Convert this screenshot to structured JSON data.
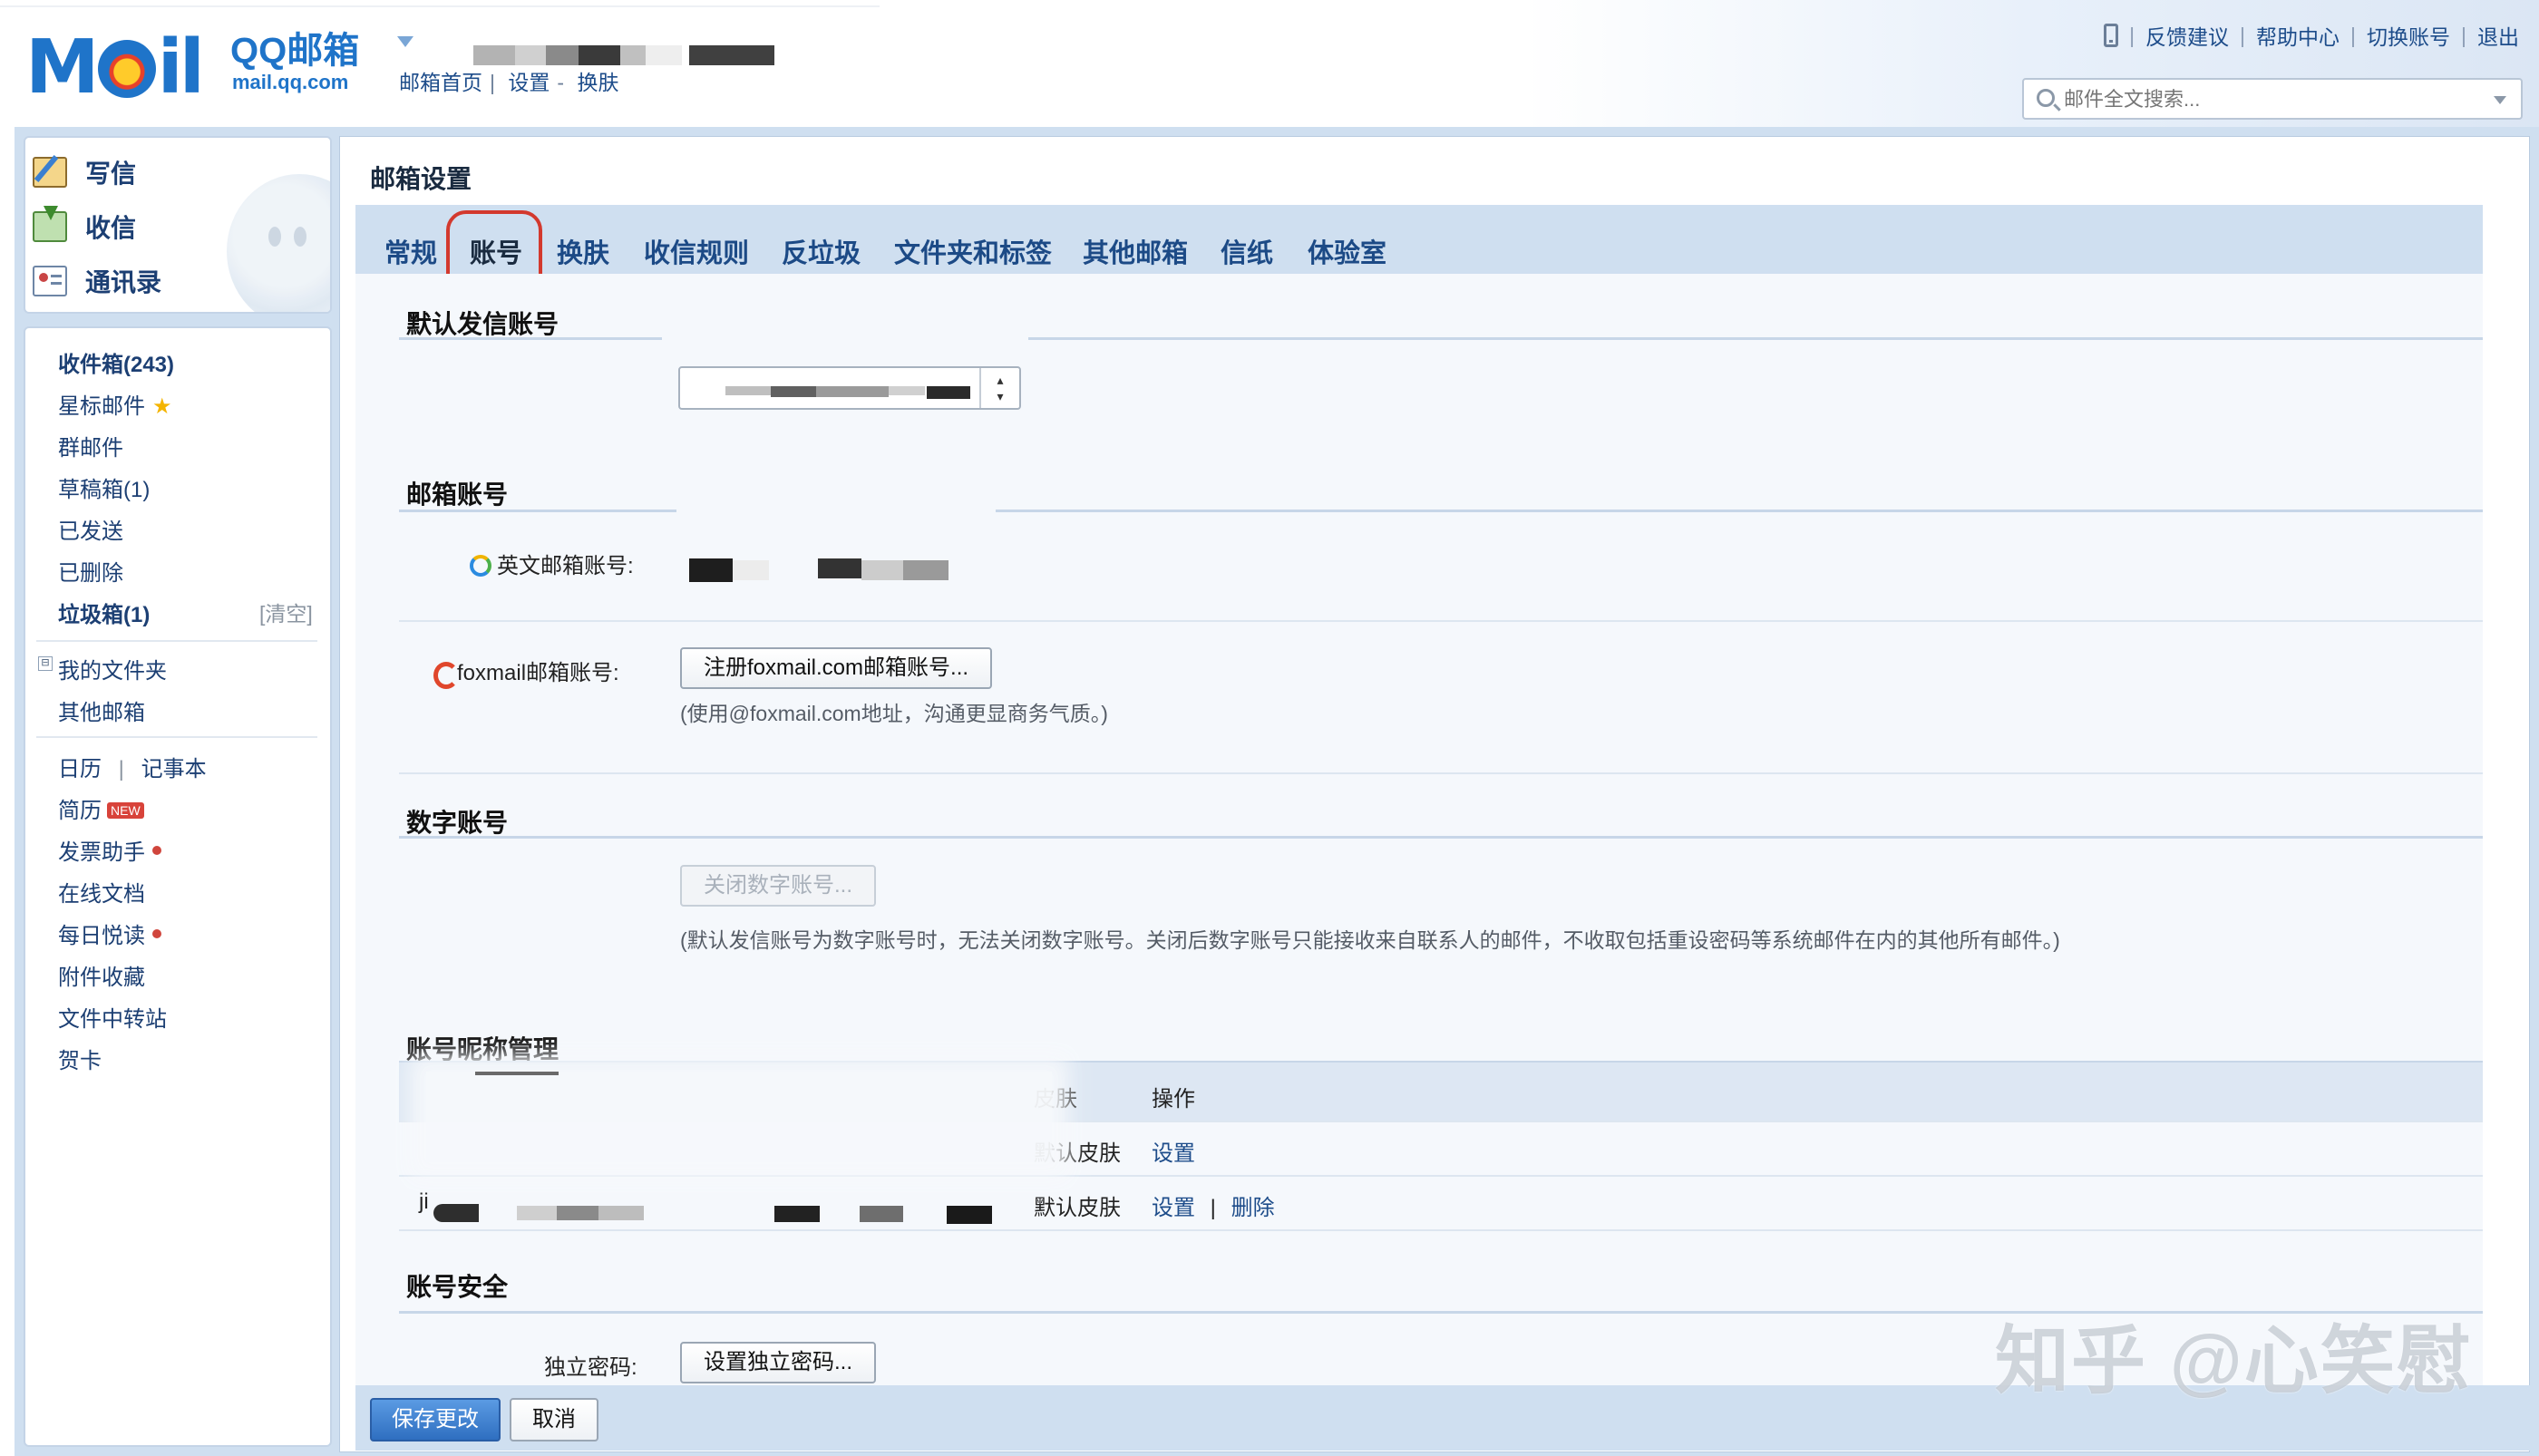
{
  "header": {
    "logo_word": "Mail",
    "logo_brand": "QQ邮箱",
    "logo_domain": "mail.qq.com",
    "breadcrumb": [
      "邮箱首页",
      "|",
      "设置",
      "-",
      "换肤"
    ],
    "top_links": [
      "反馈建议",
      "帮助中心",
      "切换账号",
      "退出"
    ],
    "search_placeholder": "邮件全文搜索..."
  },
  "sidebar": {
    "quick_actions": [
      {
        "label": "写信",
        "icon": "compose-icon"
      },
      {
        "label": "收信",
        "icon": "inbox-download-icon"
      },
      {
        "label": "通讯录",
        "icon": "contacts-icon"
      }
    ],
    "folders": [
      {
        "label": "收件箱(243)",
        "bold": true
      },
      {
        "label": "星标邮件",
        "icon": "star-icon"
      },
      {
        "label": "群邮件"
      },
      {
        "label": "草稿箱(1)"
      },
      {
        "label": "已发送"
      },
      {
        "label": "已删除"
      },
      {
        "label": "垃圾箱(1)",
        "bold": true
      }
    ],
    "clear_label": "[清空]",
    "my_folders_toggle": "⊟",
    "my_folders": "我的文件夹",
    "other_mailboxes": "其他邮箱",
    "calendar": "日历",
    "calendar_sep": "|",
    "notepad": "记事本",
    "apps": [
      {
        "label": "简历",
        "badge": "NEW"
      },
      {
        "label": "发票助手",
        "dot": true
      },
      {
        "label": "在线文档"
      },
      {
        "label": "每日悦读",
        "dot": true
      },
      {
        "label": "附件收藏"
      },
      {
        "label": "文件中转站"
      },
      {
        "label": "贺卡"
      }
    ]
  },
  "main": {
    "title": "邮箱设置",
    "tabs": [
      "常规",
      "账号",
      "换肤",
      "收信规则",
      "反垃圾",
      "文件夹和标签",
      "其他邮箱",
      "信纸",
      "体验室"
    ],
    "active_tab": "账号",
    "sections": {
      "default_sender": {
        "title": "默认发信账号"
      },
      "mailbox_account": {
        "title": "邮箱账号",
        "english_label": "英文邮箱账号:",
        "foxmail_label": "foxmail邮箱账号:",
        "foxmail_button": "注册foxmail.com邮箱账号...",
        "foxmail_hint": "(使用@foxmail.com地址，沟通更显商务气质。)"
      },
      "digital_account": {
        "title": "数字账号",
        "button": "关闭数字账号...",
        "hint": "(默认发信账号为数字账号时，无法关闭数字账号。关闭后数字账号只能接收来自联系人的邮件，不收取包括重设密码等系统邮件在内的其他所有邮件。)"
      },
      "nickname": {
        "title": "账号昵称管理",
        "headers": {
          "skin": "皮肤",
          "action": "操作"
        },
        "rows": [
          {
            "skin": "默认皮肤",
            "actions": [
              "设置"
            ]
          },
          {
            "prefix": "ji",
            "skin": "默认皮肤",
            "actions": [
              "设置",
              "|",
              "删除"
            ]
          }
        ]
      },
      "security": {
        "title": "账号安全",
        "password_label": "独立密码:",
        "password_button": "设置独立密码..."
      }
    },
    "footer": {
      "save": "保存更改",
      "cancel": "取消"
    }
  },
  "watermark": "知乎 @心笑慰",
  "colors": {
    "accent_blue": "#1f74c9",
    "frame_blue": "#cfdff0",
    "link_blue": "#1d4c8a",
    "highlight_red": "#d3392e"
  }
}
